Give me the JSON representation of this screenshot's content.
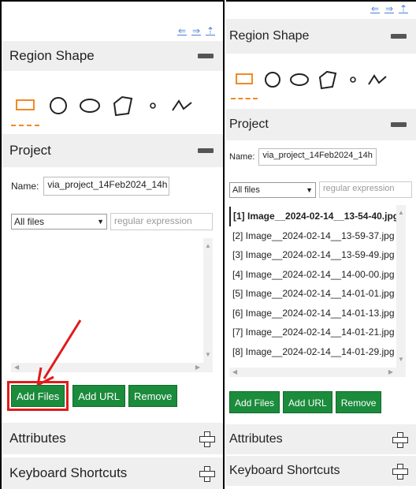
{
  "panels": {
    "region_shape_title": "Region Shape",
    "project_title": "Project",
    "name_label": "Name:",
    "project_name_value": "via_project_14Feb2024_14h",
    "filter_select_value": "All files",
    "regex_placeholder": "regular expression",
    "add_files_label": "Add Files",
    "add_url_label": "Add URL",
    "remove_label": "Remove",
    "attributes_title": "Attributes",
    "keyboard_shortcuts_title": "Keyboard Shortcuts"
  },
  "files": [
    "[1] Image__2024-02-14__13-54-40.jpg",
    "[2] Image__2024-02-14__13-59-37.jpg",
    "[3] Image__2024-02-14__13-59-49.jpg",
    "[4] Image__2024-02-14__14-00-00.jpg",
    "[5] Image__2024-02-14__14-01-01.jpg",
    "[6] Image__2024-02-14__14-01-13.jpg",
    "[7] Image__2024-02-14__14-01-21.jpg",
    "[8] Image__2024-02-14__14-01-29.jpg"
  ],
  "colors": {
    "button_green": "#1b8b3c",
    "highlight_red": "#e01b1b",
    "shape_active_orange": "#f08a24",
    "header_gray": "#efefef",
    "toolbar_blue": "#4a7fd8"
  }
}
